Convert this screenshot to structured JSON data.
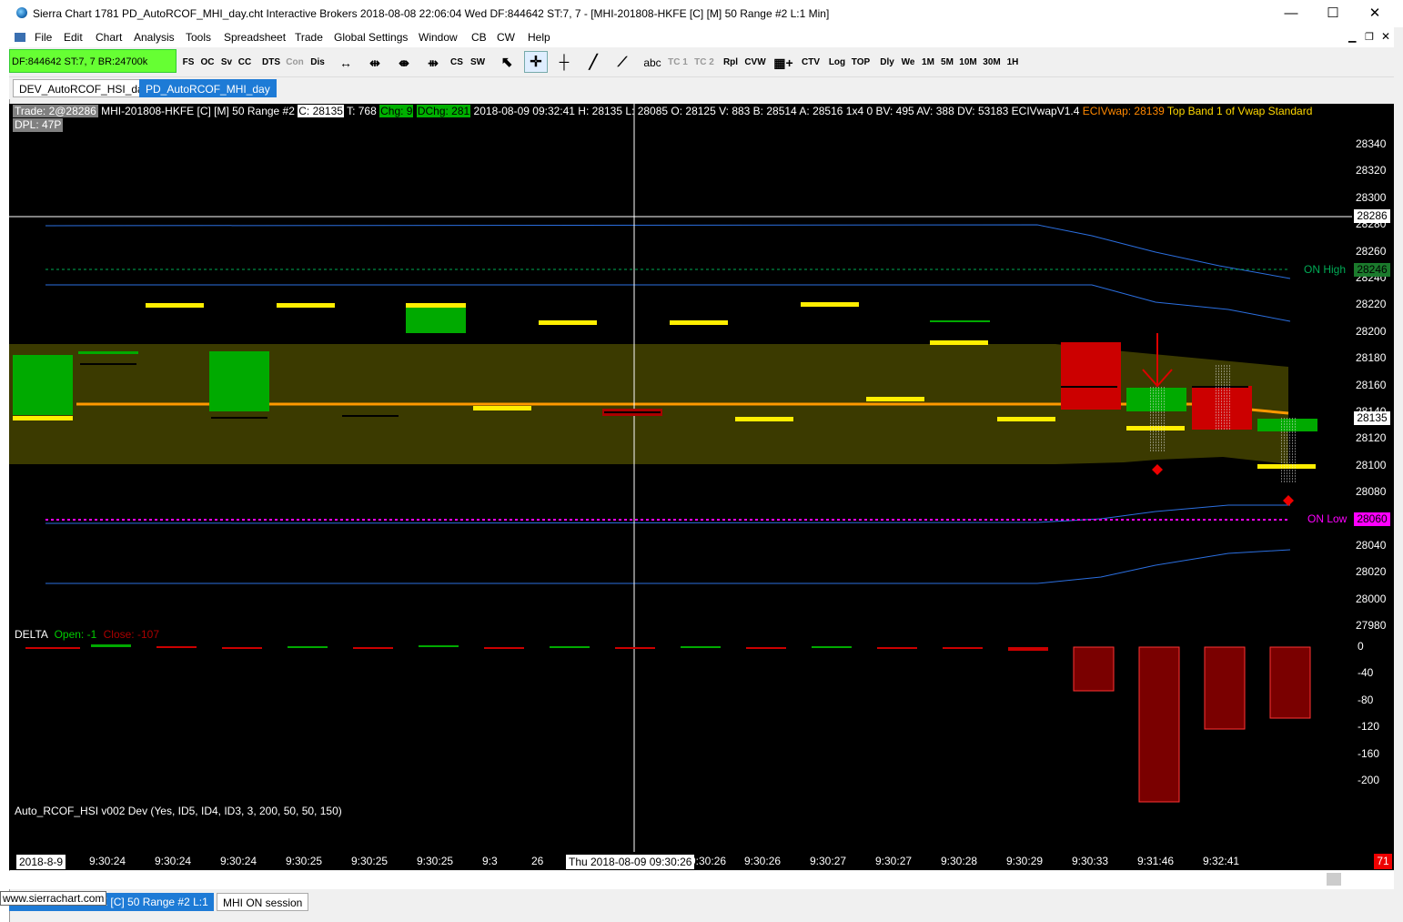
{
  "window": {
    "title": "Sierra Chart 1781 PD_AutoRCOF_MHI_day.cht  Interactive Brokers 2018-08-08  22:06:04 Wed  DF:844642  ST:7, 7 - [MHI-201808-HKFE [C] [M]  50 Range  #2  L:1  Min]",
    "minimize": "—",
    "maximize": "☐",
    "close": "✕"
  },
  "menu": [
    "File",
    "Edit",
    "Chart",
    "Analysis",
    "Tools",
    "Spreadsheet",
    "Trade",
    "Global Settings",
    "Window",
    "CB",
    "CW",
    "Help"
  ],
  "toolbar": {
    "status": "DF:844642  ST:7, 7  BR:24700k",
    "buttons": [
      "FS",
      "OC",
      "Sv",
      "CC",
      "DTS",
      "Con",
      "Dis",
      "CS",
      "SW",
      "abc",
      "TC 1",
      "TC 2",
      "Rpl",
      "CVW",
      "CTV",
      "Log",
      "TOP",
      "Dly",
      "We",
      "1M",
      "5M",
      "10M",
      "30M",
      "1H"
    ]
  },
  "chart_tabs": [
    "DEV_AutoRCOF_HSI_day",
    "PD_AutoRCOF_MHI_day"
  ],
  "header": {
    "trade": "Trade: 2@28286",
    "symbol": "MHI-201808-HKFE [C] [M]  50 Range  #2",
    "close": "C: 28135",
    "ticks": "T: 768",
    "chg": "Chg: 9",
    "dchg": "DChg: 281",
    "info": "2018-08-09  09:32:41  H: 28135  L: 28085  O: 28125  V: 883  B: 28514  A: 28516  1x4  0  BV: 495  AV: 388  DV: 53183  ECIVwapV1.4",
    "vwap": "ECIVwap: 28139",
    "band": "Top Band 1 of Vwap Standard",
    "dpl": "DPL: 47P"
  },
  "price_axis": [
    "28340",
    "28320",
    "28300",
    "28280",
    "28260",
    "28240",
    "28220",
    "28200",
    "28180",
    "28160",
    "28140",
    "28120",
    "28100",
    "28080",
    "28060",
    "28040",
    "28020",
    "28000",
    "27980"
  ],
  "price_markers": {
    "crosshair": "28286",
    "last": "28135",
    "on_high": "28246",
    "on_low": "28060"
  },
  "levels": {
    "on_high": "ON High",
    "on_low": "ON Low"
  },
  "delta": {
    "label": "DELTA",
    "open": "Open: -1",
    "close": "Close: -107",
    "axis": [
      "0",
      "-40",
      "-80",
      "-120",
      "-160",
      "-200"
    ]
  },
  "study_label": "Auto_RCOF_HSI v002 Dev  (Yes, ID5, ID4, ID3, 3, 200, 50, 50, 150)",
  "x_axis": {
    "date": "2018-8-9",
    "times": [
      "9:30:24",
      "9:30:24",
      "9:30:24",
      "9:30:25",
      "9:30:25",
      "9:30:25",
      "9:3",
      "26",
      "9:30:26",
      "9:30:26",
      "9:30:27",
      "9:30:27",
      "9:30:28",
      "9:30:29",
      "9:30:33",
      "9:31:46",
      "9:32:41"
    ],
    "crosshair": "Thu 2018-08-09  09:30:26",
    "counter": "71"
  },
  "bottom_tabs": [
    "MHI-201808-HKFE [C]  50 Range  #2  L:1",
    "MHI ON session"
  ],
  "watermark": "www.sierrachart.com",
  "colors": {
    "bull": "#00aa00",
    "bear": "#cc0000",
    "vwap": "#ff9900",
    "band": "#3a3a00",
    "cursor": "#ffffff",
    "status": "#66ff33"
  }
}
